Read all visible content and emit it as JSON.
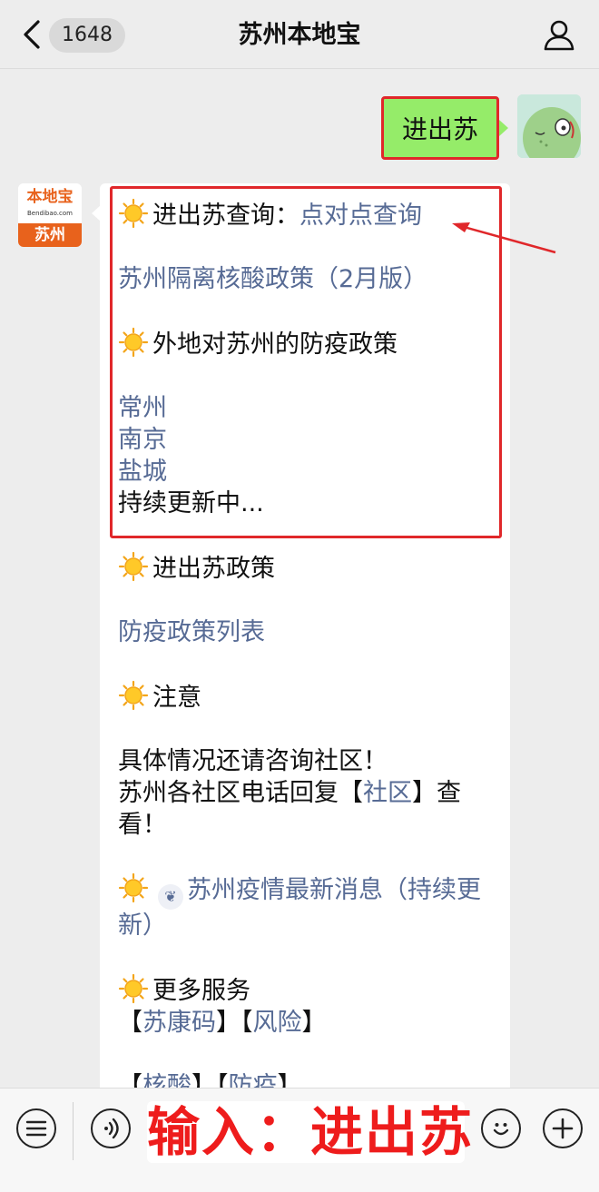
{
  "header": {
    "unread_count": "1648",
    "title": "苏州本地宝"
  },
  "sent_message": {
    "text": "进出苏"
  },
  "bot_avatar": {
    "logo_text": "本地宝",
    "logo_url": "Bendibao.com",
    "city": "苏州"
  },
  "reply": {
    "line1_prefix": "进出苏查询：",
    "line1_link": "点对点查询",
    "line2_link": "苏州隔离核酸政策（2月版）",
    "line3": "外地对苏州的防疫政策",
    "cities": [
      "常州",
      "南京",
      "盐城"
    ],
    "updating": "持续更新中...",
    "section_policy": "进出苏政策",
    "policy_link": "防疫政策列表",
    "section_notice": "注意",
    "notice_line1": "具体情况还请咨询社区！",
    "notice_line2_a": "苏州各社区电话回复【",
    "notice_line2_link": "社区",
    "notice_line2_b": "】查看！",
    "latest_link": "苏州疫情最新消息（持续更新）",
    "section_more": "更多服务",
    "more_open": "【",
    "more_link1": "苏康码",
    "more_mid": "】【",
    "more_link2": "风险",
    "more_close": "】",
    "more_link3": "核酸",
    "more_link4": "防疫"
  },
  "input_bar": {
    "overlay_text": "输入：进出苏"
  },
  "colors": {
    "link": "#576b95",
    "sent_bubble": "#95ec69",
    "highlight_red": "#e0272a",
    "brand_orange": "#e8621c"
  }
}
